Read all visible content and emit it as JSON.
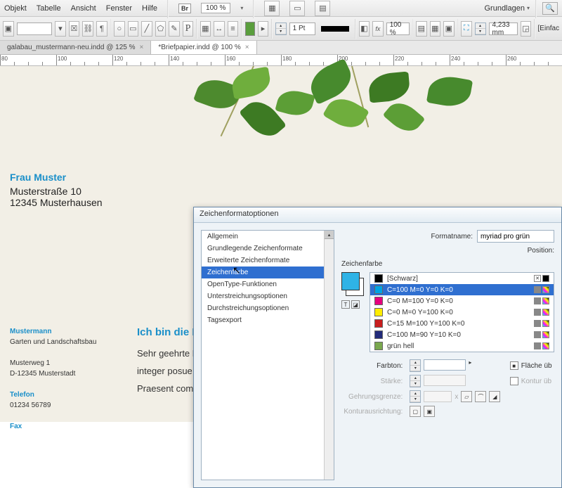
{
  "menu": {
    "items": [
      "Objekt",
      "Tabelle",
      "Ansicht",
      "Fenster",
      "Hilfe"
    ],
    "br": "Br",
    "zoom": "100 %",
    "workspace": "Grundlagen"
  },
  "toolbar": {
    "stroke_weight": "1 Pt",
    "percent": "100 %",
    "measure": "4,233 mm",
    "einfac": "[Einfac"
  },
  "tabs": [
    {
      "label": "galabau_mustermann-neu.indd @ 125 %",
      "active": false
    },
    {
      "label": "*Briefpapier.indd @ 100 %",
      "active": true
    }
  ],
  "ruler": {
    "start": 80,
    "end": 280,
    "step": 20
  },
  "document": {
    "addressee_name": "Frau Muster",
    "street": "Musterstraße 10",
    "city": "12345 Musterhausen",
    "sender_name": "Mustermann",
    "sender_line2": "Garten und Landschaftsbau",
    "sender_street": "Musterweg 1",
    "sender_city": "D-12345 Musterstadt",
    "phone_label": "Telefon",
    "phone": "01234 56789",
    "fax_label": "Fax",
    "headline": "Ich bin die H",
    "greeting": "Sehr geehrte F",
    "body1": "integer posue",
    "body2": "Praesent comm"
  },
  "dialog": {
    "title": "Zeichenformatoptionen",
    "categories": [
      "Allgemein",
      "Grundlegende Zeichenformate",
      "Erweiterte Zeichenformate",
      "Zeichenfarbe",
      "OpenType-Funktionen",
      "Unterstreichungsoptionen",
      "Durchstreichungsoptionen",
      "Tagsexport"
    ],
    "selected_category": "Zeichenfarbe",
    "formatname_label": "Formatname:",
    "formatname": "myriad pro grün",
    "position_label": "Position:",
    "section": "Zeichenfarbe",
    "swatches": [
      {
        "name": "[Schwarz]",
        "color": "#000000",
        "registration": true
      },
      {
        "name": "C=100 M=0 Y=0 K=0",
        "color": "#00a4e4",
        "selected": true
      },
      {
        "name": "C=0 M=100 Y=0 K=0",
        "color": "#e6007e"
      },
      {
        "name": "C=0 M=0 Y=100 K=0",
        "color": "#ffed00"
      },
      {
        "name": "C=15 M=100 Y=100 K=0",
        "color": "#c81e1e"
      },
      {
        "name": "C=100 M=90 Y=10 K=0",
        "color": "#222b7a"
      },
      {
        "name": "grün hell",
        "color": "#7aa84e"
      }
    ],
    "farbton_label": "Farbton:",
    "staerke_label": "Stärke:",
    "gehrung_label": "Gehrungsgrenze:",
    "kontur_label": "Konturausrichtung:",
    "fill_label": "Fläche üb",
    "stroke_label": "Kontur üb",
    "x_label": "x"
  }
}
